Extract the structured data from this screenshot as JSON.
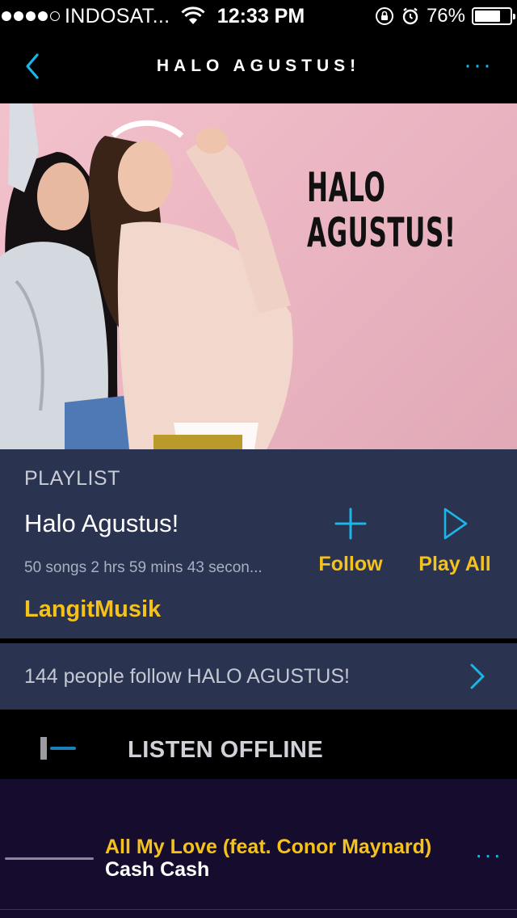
{
  "status_bar": {
    "carrier": "INDOSAT...",
    "time": "12:33 PM",
    "battery_percent_label": "76%",
    "battery_level": 0.76,
    "signal_bars_filled": 4,
    "signal_bars_total": 5
  },
  "nav": {
    "title": "HALO AGUSTUS!",
    "more_label": "···"
  },
  "hero": {
    "title_line1": "HALO",
    "title_line2": "AGUSTUS!"
  },
  "playlist": {
    "label": "PLAYLIST",
    "name": "Halo Agustus!",
    "meta": "50 songs 2 hrs 59 mins 43 secon...",
    "owner": "LangitMusik",
    "follow_label": "Follow",
    "play_all_label": "Play All"
  },
  "followers": {
    "text": "144 people follow HALO AGUSTUS!"
  },
  "offline": {
    "label": "LISTEN OFFLINE",
    "enabled": false
  },
  "tracks": [
    {
      "title": "All My Love (feat. Conor Maynard)",
      "artist": "Cash Cash",
      "more_label": "···"
    }
  ],
  "colors": {
    "accent_blue": "#1bb6e8",
    "accent_yellow": "#f5c21b",
    "panel": "#2a3350",
    "track_bg": "#160d2e"
  }
}
